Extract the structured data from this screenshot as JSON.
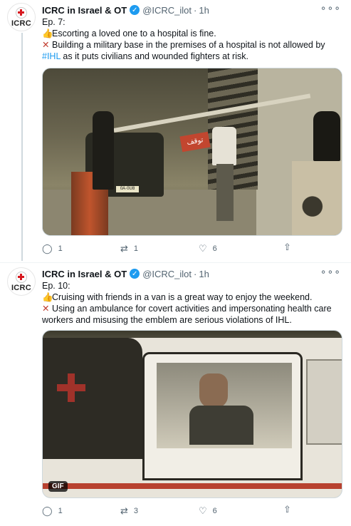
{
  "tweets": [
    {
      "avatar_text": "ICRC",
      "name": "ICRC in Israel & OT",
      "handle": "@ICRC_ilot",
      "time": "1h",
      "lines": [
        {
          "emoji": "👍",
          "text": "Ep. 7:"
        },
        {
          "emoji": "👍",
          "text": "Escorting a loved one to a hospital is fine."
        },
        {
          "emoji": "❌",
          "text": "Building a military base in the premises of a hospital is not allowed by"
        },
        {
          "hashtag": "#IHL",
          "text": " as it puts civilians and wounded fighters at risk."
        }
      ],
      "media": {
        "type": "video",
        "sign_text": "توقف",
        "plate_text": "0A·0U8"
      },
      "stats": {
        "replies": "1",
        "retweets": "1",
        "likes": "6"
      }
    },
    {
      "avatar_text": "ICRC",
      "name": "ICRC in Israel & OT",
      "handle": "@ICRC_ilot",
      "time": "1h",
      "lines": [
        {
          "text": "Ep. 10:"
        },
        {
          "emoji": "👍",
          "text": "Cruising with friends in a van is a great way to enjoy the weekend."
        },
        {
          "emoji": "❌",
          "text": "Using an ambulance for covert activities and impersonating health care"
        },
        {
          "text": "workers and misusing the emblem are serious violations of IHL."
        }
      ],
      "media": {
        "type": "gif",
        "badge": "GIF"
      },
      "stats": {
        "replies": "1",
        "retweets": "3",
        "likes": "6"
      }
    }
  ],
  "icons": {
    "verified": "verified-badge-icon",
    "more": "more-options-icon",
    "reply": "reply-icon",
    "retweet": "retweet-icon",
    "like": "like-icon",
    "share": "share-icon"
  },
  "colors": {
    "accent": "#1d9bf0",
    "secondary_text": "#536471",
    "red_cross": "#d71920"
  }
}
